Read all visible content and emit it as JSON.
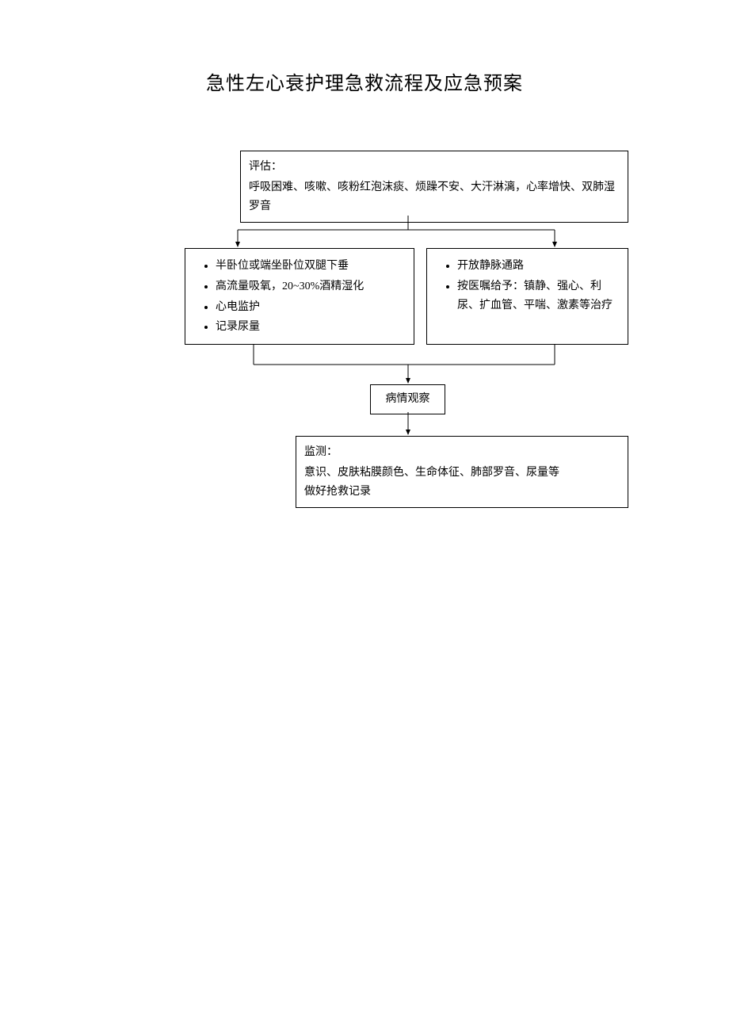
{
  "title": "急性左心衰护理急救流程及应急预案",
  "assess": {
    "label": "评估：",
    "text": "呼吸困难、咳嗽、咳粉红泡沫痰、烦躁不安、大汗淋漓，心率增快、双肺湿罗音"
  },
  "left_box": {
    "items": [
      "半卧位或端坐卧位双腿下垂",
      "高流量吸氧，20~30%酒精湿化",
      "心电监护",
      "记录尿量"
    ]
  },
  "right_box": {
    "items": [
      "开放静脉通路",
      "按医嘱给予：镇静、强心、利尿、扩血管、平喘、激素等治疗"
    ]
  },
  "observe": {
    "text": "病情观察"
  },
  "monitor": {
    "label": "监测：",
    "line1": "意识、皮肤粘膜颜色、生命体征、肺部罗音、尿量等",
    "line2": "做好抢救记录"
  }
}
